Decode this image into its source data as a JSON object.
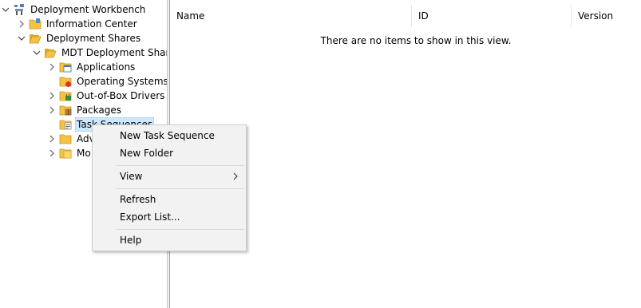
{
  "tree": {
    "root": {
      "label": "Deployment Workbench",
      "icon": "workbench-icon"
    },
    "info_center": {
      "label": "Information Center",
      "icon": "folder-icon"
    },
    "deployment_shares": {
      "label": "Deployment Shares",
      "icon": "folder-open-icon"
    },
    "mdt_share": {
      "label": "MDT Deployment Share (",
      "icon": "folder-open-icon"
    },
    "items": [
      {
        "label": "Applications",
        "icon": "applications-folder-icon"
      },
      {
        "label": "Operating Systems",
        "icon": "os-folder-icon"
      },
      {
        "label": "Out-of-Box Drivers",
        "icon": "drivers-folder-icon"
      },
      {
        "label": "Packages",
        "icon": "packages-folder-icon"
      },
      {
        "label": "Task Sequences",
        "icon": "task-sequences-folder-icon"
      },
      {
        "label": "Adv",
        "icon": "folder-icon"
      },
      {
        "label": "Mo",
        "icon": "monitoring-folder-icon"
      }
    ]
  },
  "list": {
    "columns": [
      "Name",
      "ID",
      "Version"
    ],
    "empty_message": "There are no items to show in this view."
  },
  "context_menu": {
    "items": [
      "New Task Sequence",
      "New Folder",
      "View",
      "Refresh",
      "Export List...",
      "Help"
    ]
  },
  "colors": {
    "selection": "#cce8ff",
    "menu_bg": "#f2f2f2",
    "folder": "#f5c344"
  }
}
